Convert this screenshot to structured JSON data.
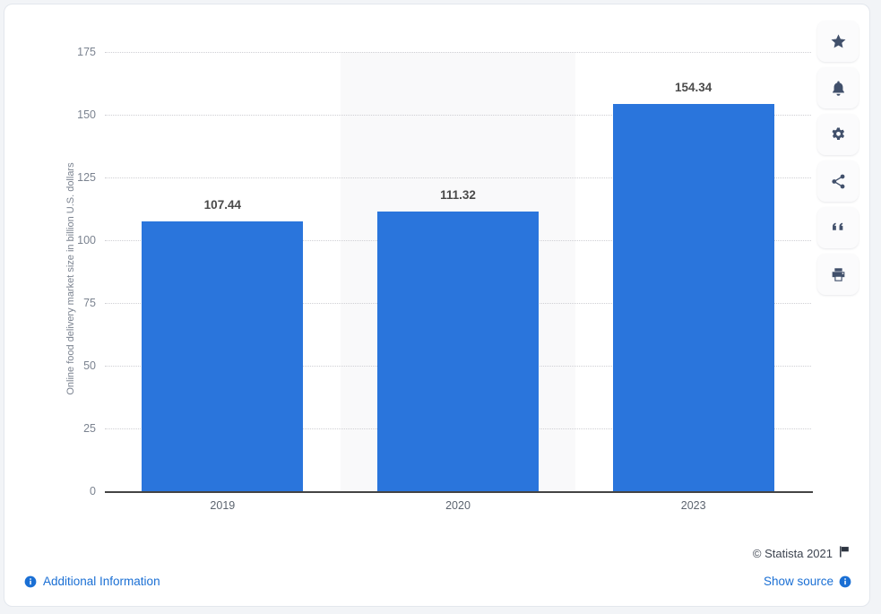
{
  "chart_data": {
    "type": "bar",
    "categories": [
      "2019",
      "2020",
      "2023"
    ],
    "values": [
      107.44,
      111.32,
      154.34
    ],
    "value_labels": [
      "107.44",
      "111.32",
      "154.34"
    ],
    "title": "",
    "xlabel": "",
    "ylabel": "Online food delivery market size in billion U.S. dollars",
    "ylim": [
      0,
      175
    ],
    "yticks": [
      0,
      25,
      50,
      75,
      100,
      125,
      150,
      175
    ],
    "ytick_labels": [
      "0",
      "25",
      "50",
      "75",
      "100",
      "125",
      "150",
      "175"
    ],
    "grid": true,
    "legend": false,
    "bar_color": "#2a75dc",
    "band_color": "#f9f9fa",
    "banded_category_index": 1
  },
  "footer": {
    "copyright": "© Statista 2021",
    "show_source": "Show source",
    "additional_information": "Additional Information"
  },
  "toolbar": {
    "items": [
      {
        "name": "star-icon",
        "label": "Favorite"
      },
      {
        "name": "bell-icon",
        "label": "Notifications"
      },
      {
        "name": "gear-icon",
        "label": "Settings"
      },
      {
        "name": "share-icon",
        "label": "Share"
      },
      {
        "name": "quote-icon",
        "label": "Cite"
      },
      {
        "name": "print-icon",
        "label": "Print"
      }
    ]
  },
  "icons": {
    "flag": "flag-icon",
    "info": "info-icon"
  }
}
